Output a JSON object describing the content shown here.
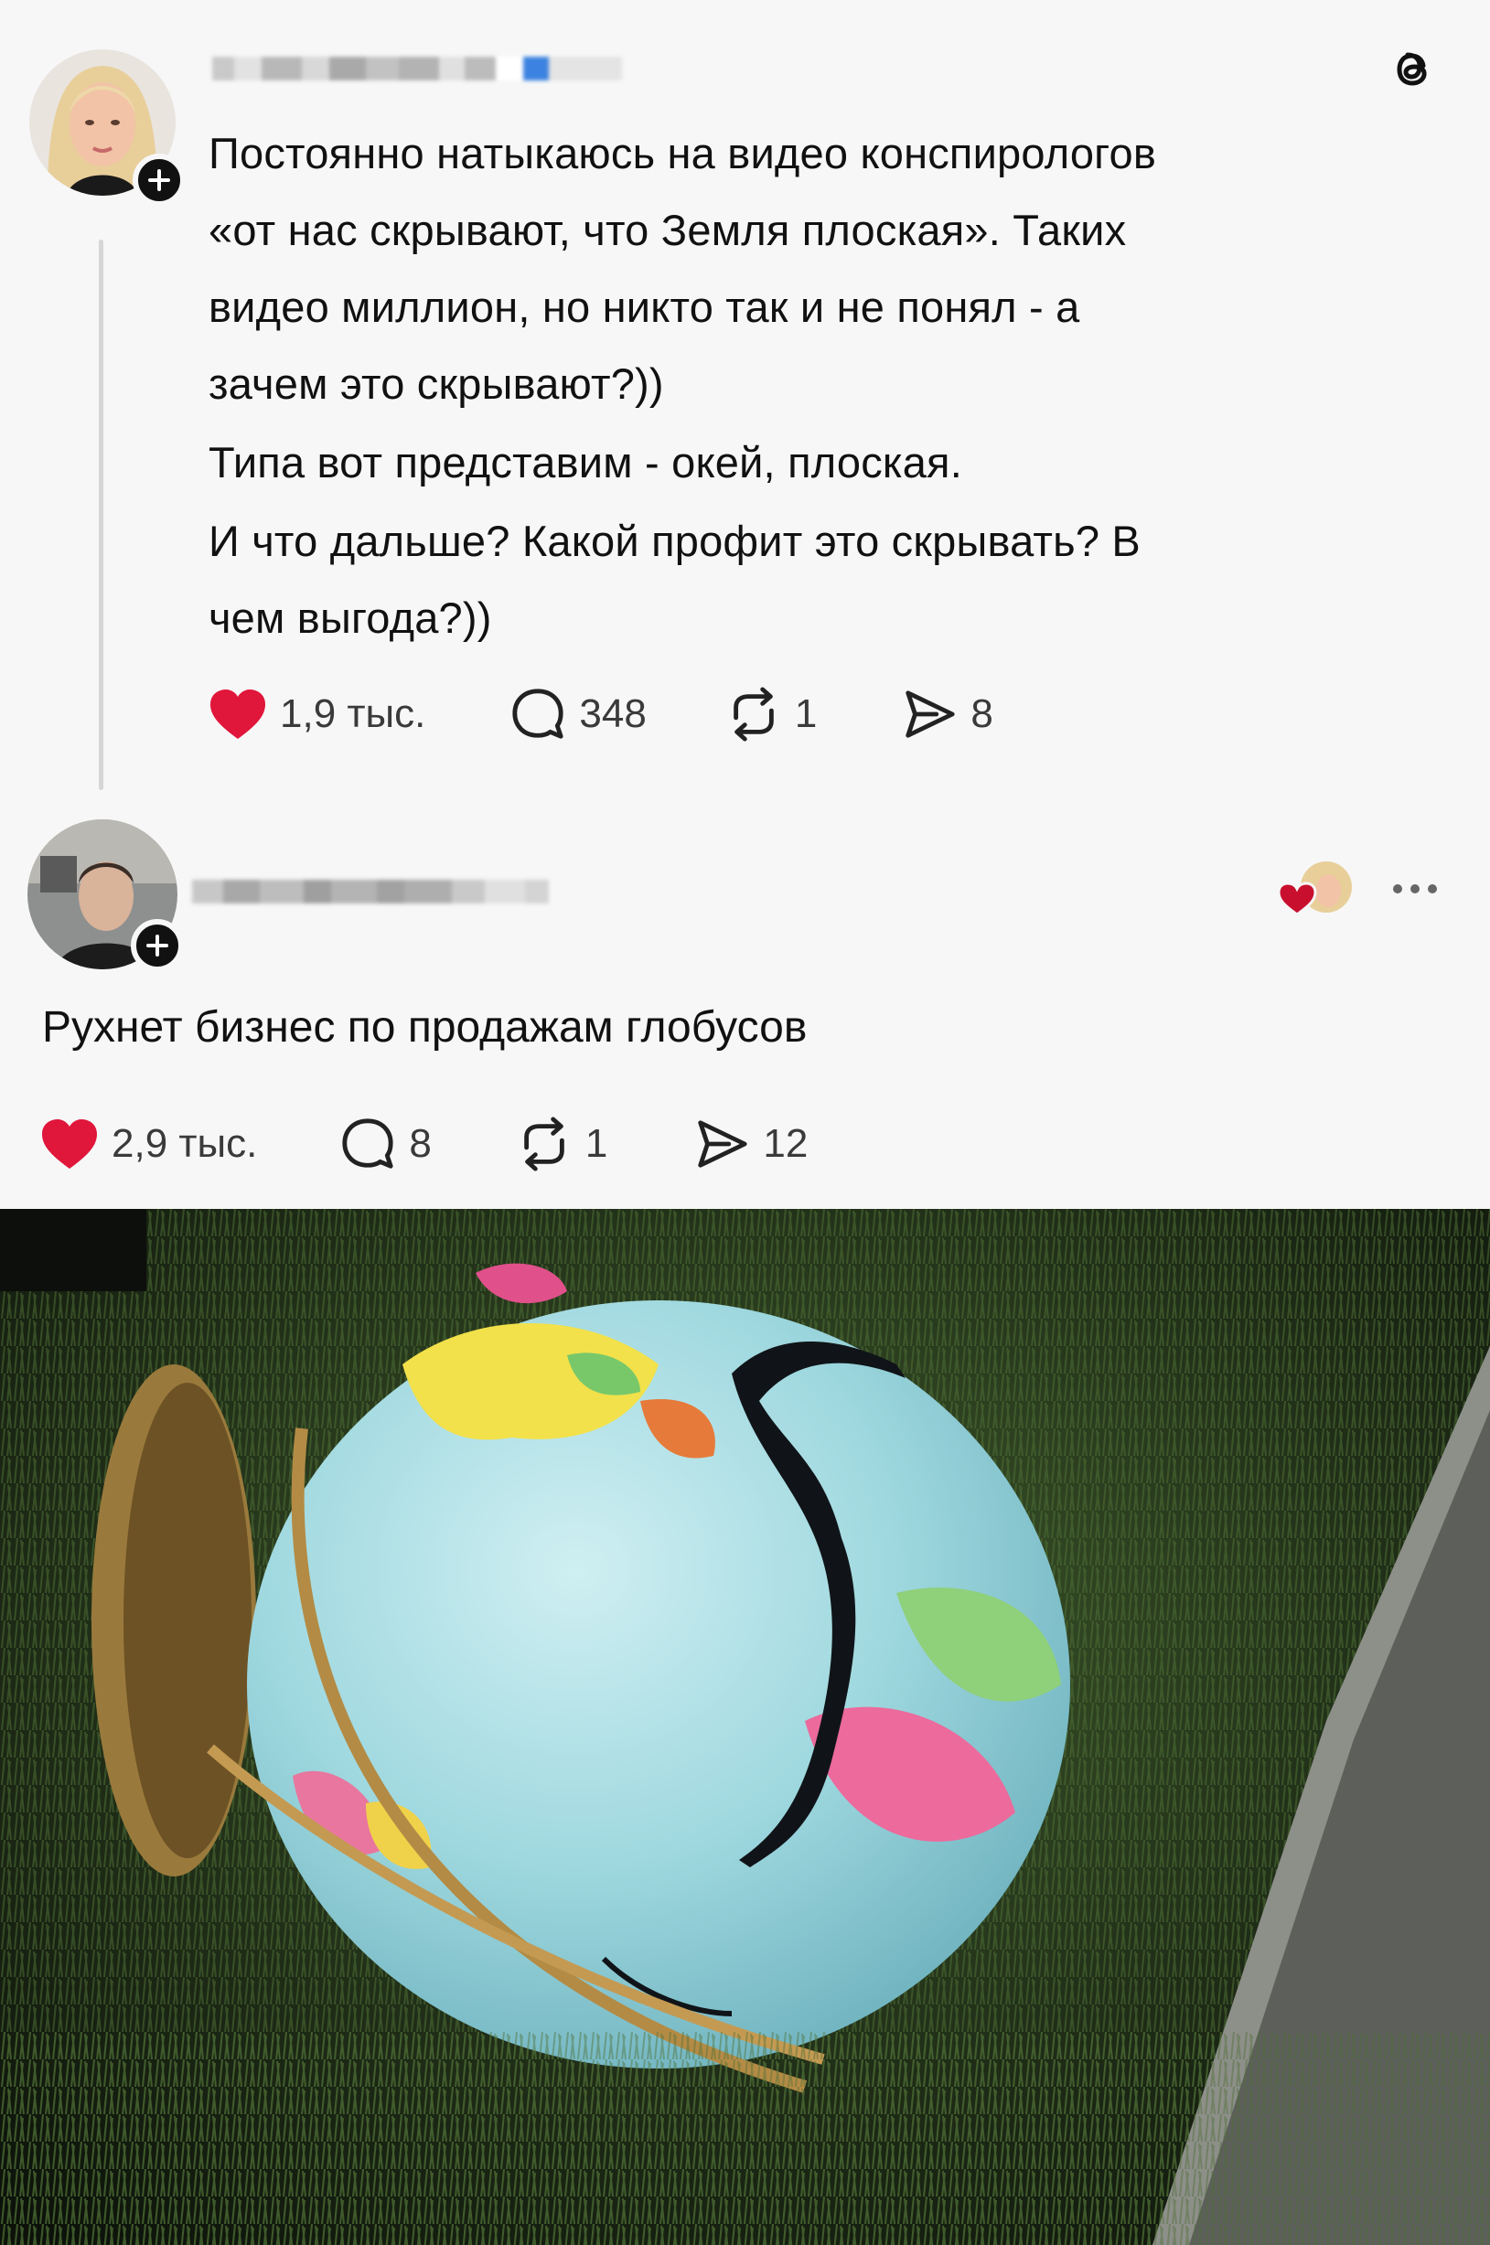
{
  "app": {
    "logo_icon": "threads-icon"
  },
  "post": {
    "author_name": "",
    "text": {
      "line1": "Постоянно натыкаюсь на видео конспирологов",
      "line2": "«от нас скрывают, что Земля плоская». Таких",
      "line3": "видео миллион, но никто так и не понял - а",
      "line4": "зачем это скрывают?))",
      "line5": "Типа вот представим - окей, плоская.",
      "line6": "И что дальше? Какой профит это скрывать? В",
      "line7": "чем выгода?))"
    },
    "likes": "1,9 тыс.",
    "comments": "348",
    "reposts": "1",
    "shares": "8",
    "liked": true
  },
  "reply": {
    "author_name": "",
    "text": "Рухнет бизнес по продажам глобусов",
    "likes": "2,9 тыс.",
    "comments": "8",
    "reposts": "1",
    "shares": "12",
    "liked": true,
    "liked_by_author_icon": "heart-avatar-icon",
    "more_icon": "more-dots-icon"
  },
  "colors": {
    "heart": "#e0163b",
    "background": "#f7f7f7",
    "text": "#111111",
    "muted": "#444444"
  }
}
